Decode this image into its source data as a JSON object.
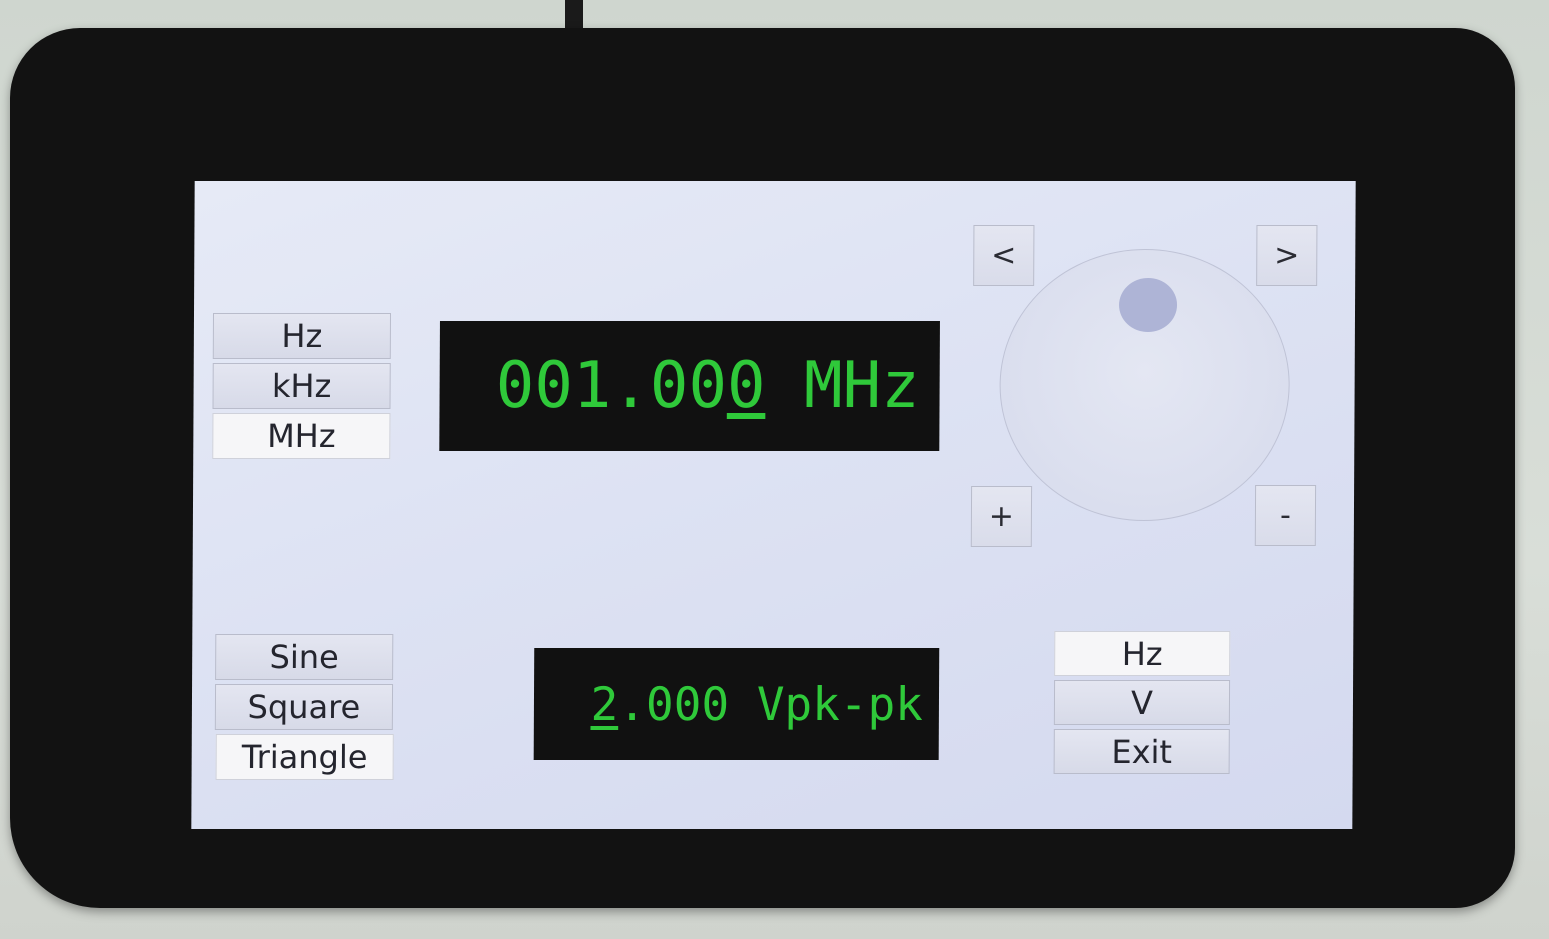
{
  "units": {
    "items": [
      {
        "label": "Hz"
      },
      {
        "label": "kHz"
      },
      {
        "label": "MHz"
      }
    ],
    "selected": "MHz"
  },
  "frequency_display": {
    "value_before_cursor": "001.00",
    "cursor_digit": "0",
    "unit": " MHz"
  },
  "waveforms": {
    "items": [
      {
        "label": "Sine"
      },
      {
        "label": "Square"
      },
      {
        "label": "Triangle"
      }
    ],
    "selected": "Triangle"
  },
  "amplitude_display": {
    "cursor_digit": "2",
    "value_after_cursor": ".000 Vpk-pk"
  },
  "nav": {
    "left_label": "<",
    "right_label": ">",
    "plus_label": "+",
    "minus_label": "-"
  },
  "mode": {
    "items": [
      {
        "label": "Hz"
      },
      {
        "label": "V"
      },
      {
        "label": "Exit"
      }
    ],
    "selected": "Hz"
  },
  "colors": {
    "display_text": "#2fc93a",
    "display_bg": "#111111",
    "screen_bg": "#dde2f3",
    "dial_knob": "#aeb4d6"
  }
}
